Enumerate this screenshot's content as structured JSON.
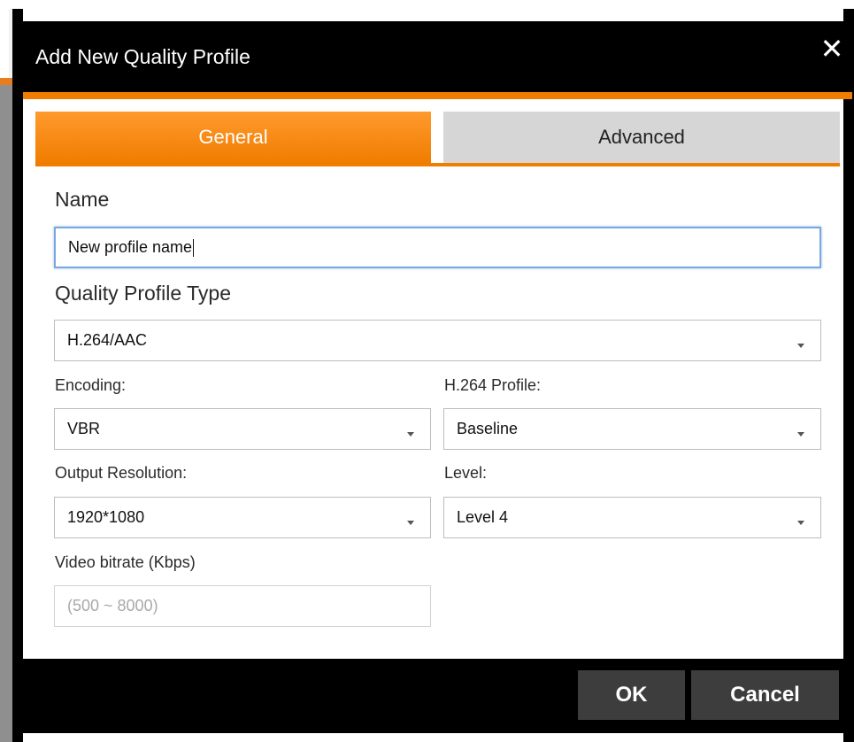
{
  "dialog": {
    "title": "Add New Quality Profile",
    "close_glyph": "✕"
  },
  "tabs": [
    {
      "label": "General",
      "active": true
    },
    {
      "label": "Advanced",
      "active": false
    }
  ],
  "form": {
    "name_label": "Name",
    "name_value": "New profile name",
    "type_label": "Quality Profile Type",
    "type_value": "H.264/AAC",
    "encoding_label": "Encoding:",
    "encoding_value": "VBR",
    "h264_profile_label": "H.264 Profile:",
    "h264_profile_value": "Baseline",
    "resolution_label": "Output Resolution:",
    "resolution_value": "1920*1080",
    "level_label": "Level:",
    "level_value": "Level 4",
    "bitrate_label": "Video bitrate (Kbps)",
    "bitrate_placeholder": "(500 ~ 8000)"
  },
  "footer": {
    "ok_label": "OK",
    "cancel_label": "Cancel"
  },
  "colors": {
    "accent": "#f07d00",
    "titlebar": "#000000",
    "button": "#3d3d3d"
  },
  "icons": [
    "close-icon",
    "chevron-down-icon"
  ]
}
